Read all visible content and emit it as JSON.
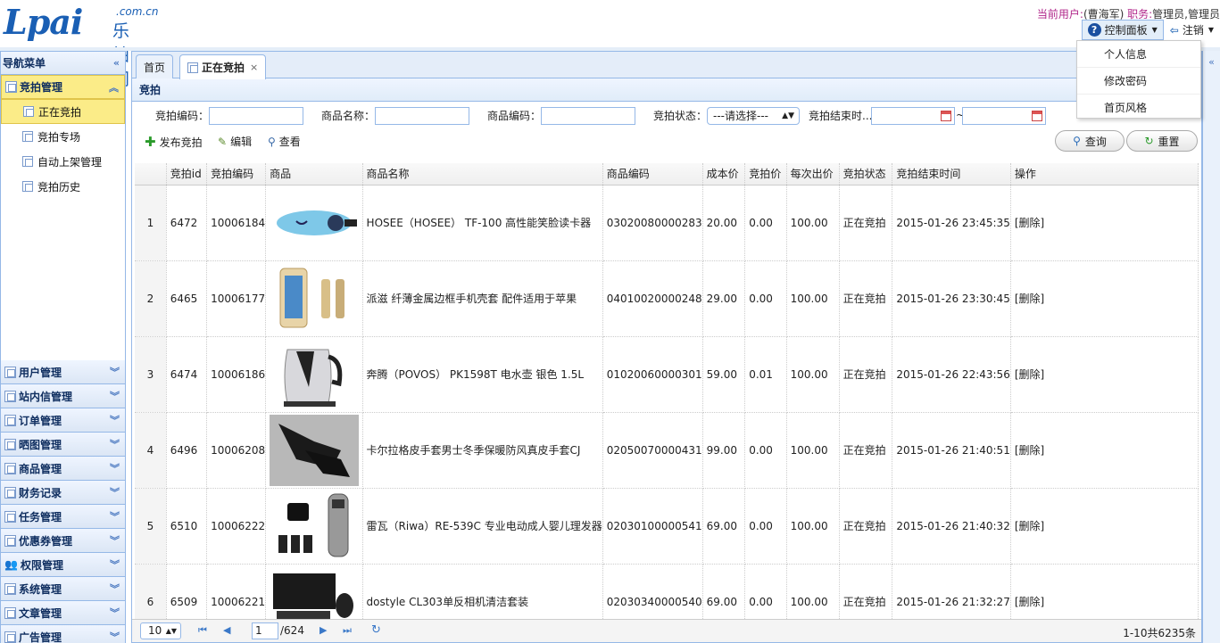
{
  "header": {
    "logo_main": "Lpai",
    "logo_domain": ".com.cn",
    "logo_cn": "乐拍网",
    "user_label": "当前用户:",
    "user_value": "(曹海军)",
    "role_label": " 职务:",
    "role_value": "管理员,管理员",
    "control_panel": "控制面板",
    "logout": "注销"
  },
  "dropdown": {
    "items": [
      "个人信息",
      "修改密码",
      "首页风格"
    ]
  },
  "sidebar": {
    "title": "导航菜单",
    "active_group": "竞拍管理",
    "sub_items": [
      "正在竞拍",
      "竞拍专场",
      "自动上架管理",
      "竞拍历史"
    ],
    "groups": [
      "用户管理",
      "站内信管理",
      "订单管理",
      "晒图管理",
      "商品管理",
      "财务记录",
      "任务管理",
      "优惠券管理",
      "权限管理",
      "系统管理",
      "文章管理",
      "广告管理"
    ]
  },
  "tabs": {
    "home": "首页",
    "current": "正在竞拍",
    "close": "×"
  },
  "panel": {
    "title": "竞拍"
  },
  "filters": {
    "auction_code": "竞拍编码：",
    "product_name": "商品名称：",
    "product_code": "商品编码：",
    "status": "竞拍状态：",
    "status_value": "---请选择---",
    "end_time": "竞拍结束时...",
    "tilde": "~"
  },
  "toolbar": {
    "publish": "发布竞拍",
    "edit": "编辑",
    "view": "查看",
    "search": "查询",
    "reset": "重置"
  },
  "table": {
    "headers": [
      "",
      "竞拍id",
      "竞拍编码",
      "商品",
      "商品名称",
      "商品编码",
      "成本价",
      "竞拍价",
      "每次出价",
      "竞拍状态",
      "竞拍结束时间",
      "操作"
    ],
    "rows": [
      {
        "n": "1",
        "id": "6472",
        "code": "10006184",
        "name": "HOSEE（HOSEE） TF-100 高性能笑脸读卡器",
        "pcode": "03020080000283",
        "cost": "20.00",
        "price": "0.00",
        "step": "100.00",
        "status": "正在竞拍",
        "end": "2015-01-26 23:45:35",
        "op": "[删除]"
      },
      {
        "n": "2",
        "id": "6465",
        "code": "10006177",
        "name": "派滋 纤薄金属边框手机壳套 配件适用于苹果",
        "pcode": "04010020000248",
        "cost": "29.00",
        "price": "0.00",
        "step": "100.00",
        "status": "正在竞拍",
        "end": "2015-01-26 23:30:45",
        "op": "[删除]"
      },
      {
        "n": "3",
        "id": "6474",
        "code": "10006186",
        "name": "奔腾（POVOS） PK1598T 电水壶 银色 1.5L",
        "pcode": "01020060000301",
        "cost": "59.00",
        "price": "0.01",
        "step": "100.00",
        "status": "正在竞拍",
        "end": "2015-01-26 22:43:56",
        "op": "[删除]"
      },
      {
        "n": "4",
        "id": "6496",
        "code": "10006208",
        "name": "卡尔拉格皮手套男士冬季保暖防风真皮手套CJ",
        "pcode": "02050070000431",
        "cost": "99.00",
        "price": "0.00",
        "step": "100.00",
        "status": "正在竞拍",
        "end": "2015-01-26 21:40:51",
        "op": "[删除]"
      },
      {
        "n": "5",
        "id": "6510",
        "code": "10006222",
        "name": "雷瓦（Riwa）RE-539C 专业电动成人婴儿理发器",
        "pcode": "02030100000541",
        "cost": "69.00",
        "price": "0.00",
        "step": "100.00",
        "status": "正在竞拍",
        "end": "2015-01-26 21:40:32",
        "op": "[删除]"
      },
      {
        "n": "6",
        "id": "6509",
        "code": "10006221",
        "name": "dostyle CL303单反相机清洁套装",
        "pcode": "02030340000540",
        "cost": "69.00",
        "price": "0.00",
        "step": "100.00",
        "status": "正在竞拍",
        "end": "2015-01-26 21:32:27",
        "op": "[删除]"
      }
    ]
  },
  "pager": {
    "size": "10",
    "page": "1",
    "total": "/624",
    "info": "1-10共6235条"
  }
}
